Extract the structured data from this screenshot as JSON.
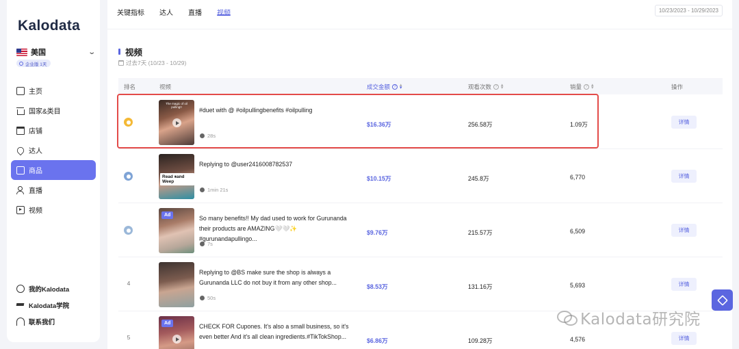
{
  "sidebar": {
    "logo": "Kalodata",
    "region": "美国",
    "plan_badge": "企业版 1天",
    "nav": [
      {
        "label": "主页",
        "icon": "home-icon"
      },
      {
        "label": "国家&类目",
        "icon": "bank-icon"
      },
      {
        "label": "店铺",
        "icon": "store-icon"
      },
      {
        "label": "达人",
        "icon": "location-pin-icon"
      },
      {
        "label": "商品",
        "icon": "box-icon",
        "active": true
      },
      {
        "label": "直播",
        "icon": "users-icon"
      },
      {
        "label": "视频",
        "icon": "video-icon"
      }
    ],
    "bottom": [
      {
        "label": "我的Kalodata",
        "icon": "user-icon"
      },
      {
        "label": "Kalodata学院",
        "icon": "graduation-cap-icon"
      },
      {
        "label": "联系我们",
        "icon": "headset-icon"
      }
    ]
  },
  "header": {
    "tabs": [
      "关键指标",
      "达人",
      "直播",
      "视频"
    ],
    "active_tab": "视频",
    "date_range": "10/23/2023 - 10/29/2023"
  },
  "section": {
    "title": "视频",
    "subtitle": "过去7天 (10/23 - 10/29)"
  },
  "table": {
    "headers": {
      "rank": "排名",
      "video": "视频",
      "gmv": "成交金额",
      "views": "观看次数",
      "sales": "销量",
      "action": "操作"
    },
    "rows": [
      {
        "rank": "1",
        "medal": "gold",
        "desc": "#duet with @ #oilpullingbenefits #oilpulling",
        "duration": "28s",
        "gmv": "$16.36万",
        "views": "256.58万",
        "sales": "1.09万",
        "detail": "详情",
        "thumb_caption": "The magic of oil pulling!!"
      },
      {
        "rank": "2",
        "medal": "silver",
        "desc": "Replying to @user2416008782537",
        "duration": "1min 21s",
        "gmv": "$10.15万",
        "views": "245.8万",
        "sales": "6,770",
        "detail": "详情",
        "thumb_overlay": "Read ⏸and Weep"
      },
      {
        "rank": "3",
        "medal": "bronze",
        "desc": "So many benefits!! My dad used to work for Gurunanda their products are AMAZING🤍🤍✨ #gurunandapullingo...",
        "duration": "7s",
        "gmv": "$9.76万",
        "views": "215.57万",
        "sales": "6,509",
        "detail": "详情",
        "ad": "Ad"
      },
      {
        "rank": "4",
        "desc": "Replying to @BS make sure the shop is always a Gurunanda LLC do not buy it from any other shop...",
        "duration": "50s",
        "gmv": "$8.53万",
        "views": "131.16万",
        "sales": "5,693",
        "detail": "详情"
      },
      {
        "rank": "5",
        "desc": "CHECK FOR Cupones. It's also a small business, so it's even better And it's all clean ingredients.#TikTokShop...",
        "duration": "",
        "gmv": "$6.86万",
        "views": "109.28万",
        "sales": "4,576",
        "detail": "详情",
        "ad": "Ad"
      }
    ]
  },
  "watermark": "Kalodata研究院",
  "colors": {
    "accent": "#5b66e0",
    "highlight": "#e34a48",
    "nav_active": "#6a73ee"
  }
}
